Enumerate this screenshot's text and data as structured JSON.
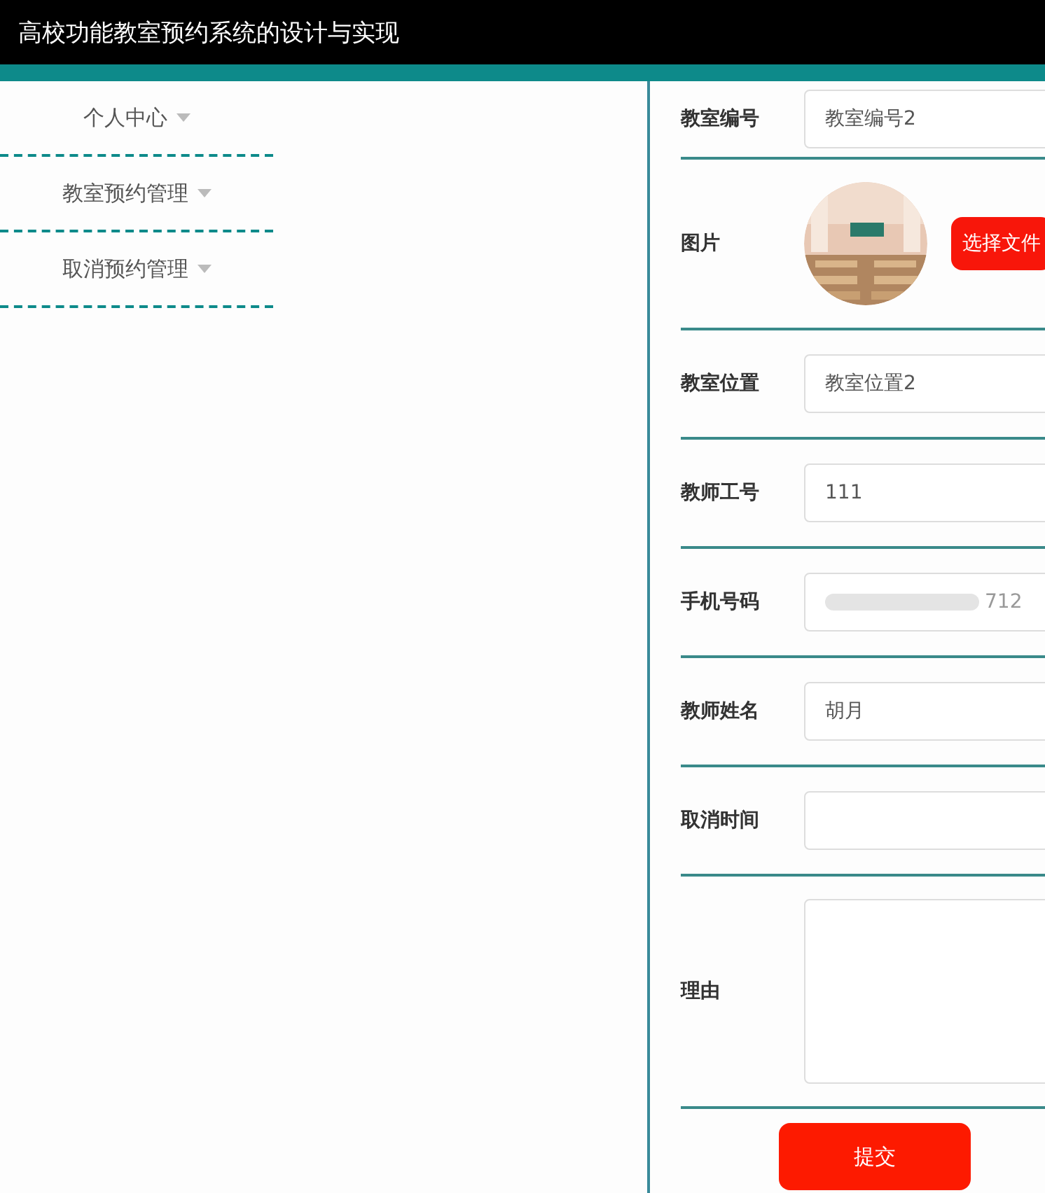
{
  "header": {
    "title": "高校功能教室预约系统的设计与实现"
  },
  "sidebar": {
    "items": [
      {
        "label": "个人中心",
        "expanded": false
      },
      {
        "label": "教室预约管理",
        "expanded": false
      },
      {
        "label": "取消预约管理",
        "expanded": false
      }
    ]
  },
  "form": {
    "fields": [
      {
        "kind": "input",
        "label": "教室编号",
        "value": "教室编号2"
      },
      {
        "label": "图片",
        "button": "选择文件"
      },
      {
        "kind": "input",
        "label": "教室位置",
        "value": "教室位置2"
      },
      {
        "kind": "input",
        "label": "教师工号",
        "value": "111"
      },
      {
        "kind": "redacted",
        "label": "手机号码",
        "value": "712"
      },
      {
        "kind": "input",
        "label": "教师姓名",
        "value": "胡月"
      },
      {
        "kind": "input",
        "label": "取消时间"
      },
      {
        "kind": "textarea",
        "label": "理由"
      }
    ],
    "submit": "提交"
  }
}
